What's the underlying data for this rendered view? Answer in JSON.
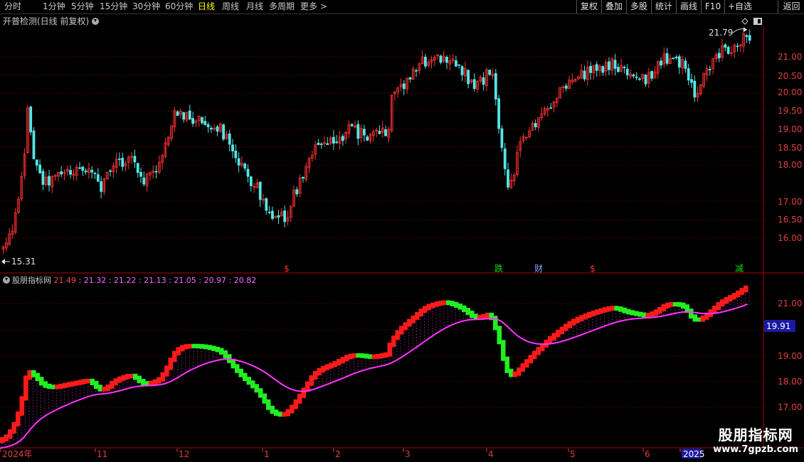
{
  "toolbar": {
    "periods": [
      "分时",
      "1分钟",
      "5分钟",
      "15分钟",
      "30分钟",
      "60分钟",
      "日线",
      "周线",
      "月线",
      "多周期",
      "更多 >"
    ],
    "active_period": "日线",
    "actions": [
      "复权",
      "叠加",
      "多股",
      "统计",
      "画线",
      "F10",
      "+自选",
      "返回"
    ]
  },
  "main_panel": {
    "title": "开普检测(日线 前复权)",
    "high_label": "21.79",
    "low_label": "15.31",
    "y_ticks": [
      "21.00",
      "20.50",
      "20.00",
      "19.50",
      "19.00",
      "18.50",
      "18.00",
      "17.00",
      "16.50",
      "16.00"
    ],
    "event_markers": [
      {
        "glyph": "$",
        "color": "#ff3030"
      },
      {
        "glyph": "跌",
        "color": "#00e000"
      },
      {
        "glyph": "财",
        "color": "#7fa0ff"
      },
      {
        "glyph": "$",
        "color": "#ff3030"
      },
      {
        "glyph": "减",
        "color": "#00e000"
      }
    ],
    "colors": {
      "up": "#ff3333",
      "down": "#55e5e5",
      "grid": "#8b0000"
    }
  },
  "sub_panel": {
    "title": "股朋指标网",
    "values": [
      "21.49",
      "21.32",
      "21.22",
      "21.13",
      "21.05",
      "20.97",
      "20.82"
    ],
    "y_ticks": [
      "21.00",
      "19.00",
      "18.00",
      "17.00"
    ],
    "current_value": "19.91",
    "colors": {
      "rise": "#ff1a1a",
      "fall": "#22ee22",
      "ma": "#ff33ff",
      "ma2": "#33dd33"
    }
  },
  "x_axis": {
    "labels": [
      "2024年",
      "11",
      "12",
      "1",
      "2",
      "3",
      "4",
      "5",
      "6",
      "2025"
    ]
  },
  "watermark": {
    "title": "股朋指标网",
    "url": "www.7gpzb.com"
  }
}
